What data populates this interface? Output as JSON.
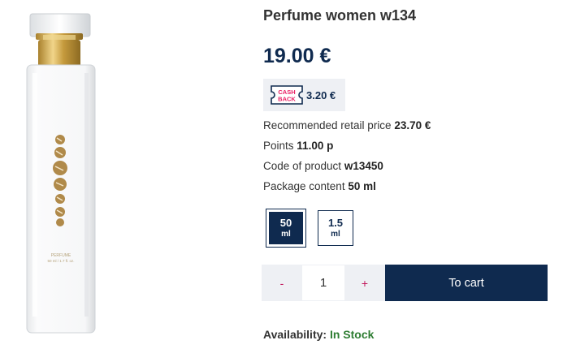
{
  "product": {
    "title": "Perfume women w134",
    "price": "19.00 €",
    "bottle_label_line1": "PERFUME",
    "bottle_label_line2": "50 ml / 1.7 fl. oz."
  },
  "cashback": {
    "logo_line1": "CASH",
    "logo_line2": "BACK",
    "amount": "3.20 €"
  },
  "info": {
    "retail_label": "Recommended retail price",
    "retail_value": "23.70 €",
    "points_label": "Points",
    "points_value": "11.00 p",
    "code_label": "Code of product",
    "code_value": "w13450",
    "package_label": "Package content",
    "package_value": "50 ml"
  },
  "variants": [
    {
      "number": "50",
      "unit": "ml",
      "selected": true
    },
    {
      "number": "1.5",
      "unit": "ml",
      "selected": false
    }
  ],
  "cart": {
    "minus_label": "-",
    "quantity": "1",
    "plus_label": "+",
    "button_label": "To cart"
  },
  "availability": {
    "label": "Availability:",
    "status": "In Stock"
  },
  "colors": {
    "brand_navy": "#0f2a4f",
    "stepper_bg": "#eef0f4",
    "stepper_accent": "#c2185b",
    "in_stock": "#2e7d32",
    "bottle_cap": "#c8a24a"
  }
}
